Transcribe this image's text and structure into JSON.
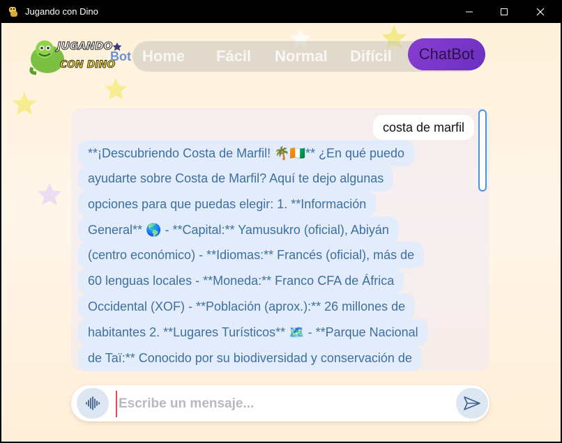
{
  "window": {
    "title": "Jugando con Dino"
  },
  "logo": {
    "line1": "JUGANDO",
    "line2": "CON DINO",
    "suffix": "Bot"
  },
  "nav": {
    "items": [
      {
        "label": "Home"
      },
      {
        "label": "Fácil"
      },
      {
        "label": "Normal"
      },
      {
        "label": "Difícil"
      },
      {
        "label": "ChatBot"
      }
    ]
  },
  "chat": {
    "user_message": "costa de marfil",
    "bot_lines": [
      "**¡Descubriendo Costa de Marfil! 🌴🇨🇮** ¿En qué puedo",
      "ayudarte sobre Costa de Marfil? Aquí te dejo algunas",
      "opciones para que puedas elegir: 1. **Información",
      "General** 🌎 - **Capital:** Yamusukro (oficial), Abiyán",
      "(centro económico) - **Idiomas:** Francés (oficial), más de",
      "60 lenguas locales - **Moneda:** Franco CFA de África",
      "Occidental (XOF) - **Población (aprox.):** 26 millones de",
      "habitantes 2. **Lugares Turísticos** 🗺️ - **Parque Nacional",
      "de Taï:** Conocido por su biodiversidad y conservación de"
    ]
  },
  "input": {
    "placeholder": "Escribe un mensaje...",
    "value": ""
  },
  "icons": {
    "mic": "audio-waveform-icon",
    "send": "send-icon"
  },
  "colors": {
    "chat_button": "#7a35c8",
    "bot_bubble": "#e2ecfb",
    "bot_text": "#3d6fa0",
    "scroll_thumb_border": "#4f8fe0"
  }
}
